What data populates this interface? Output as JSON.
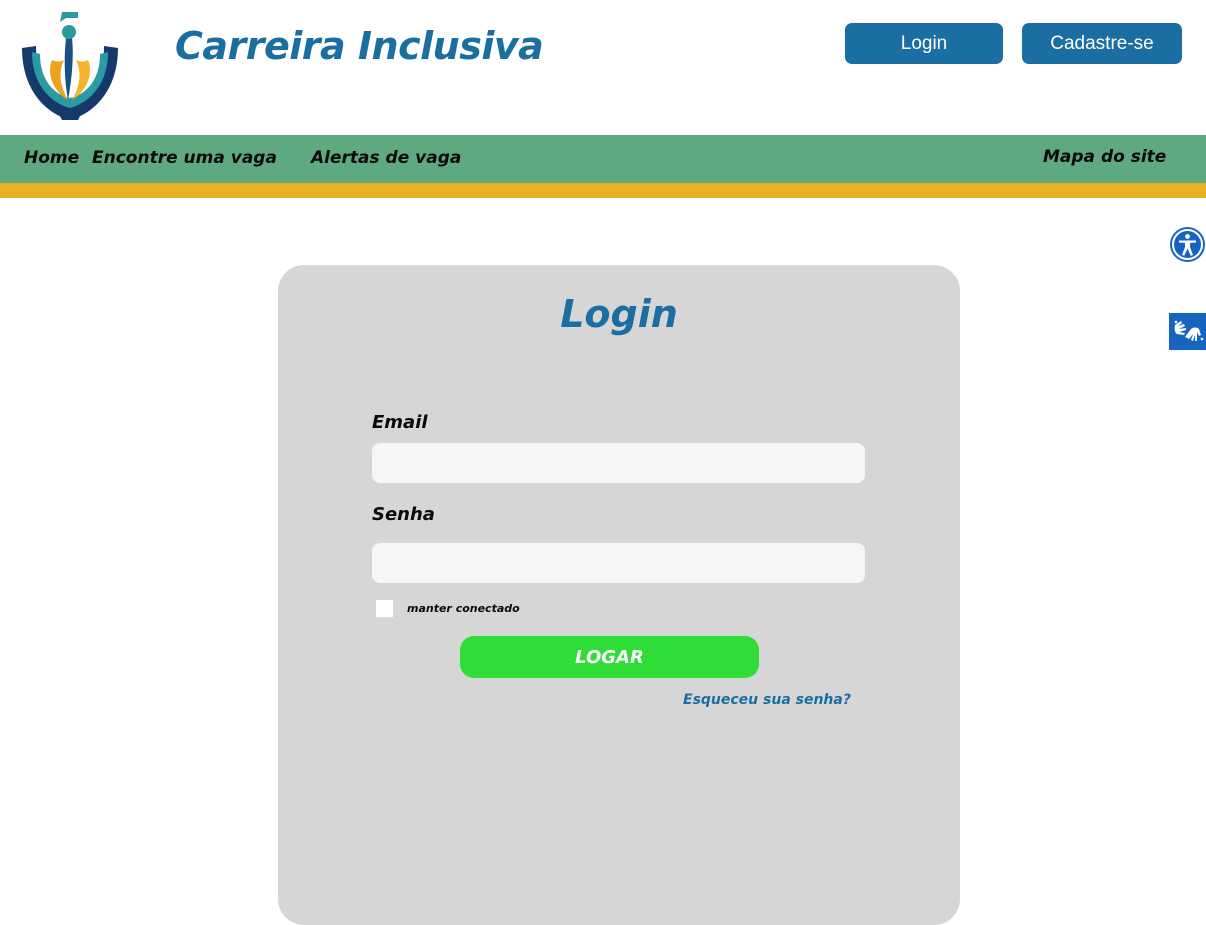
{
  "header": {
    "brand_name": "Carreira Inclusiva",
    "login_label": "Login",
    "signup_label": "Cadastre-se"
  },
  "nav": {
    "home": "Home",
    "find_job": "Encontre uma vaga",
    "job_alerts": "Alertas de vaga",
    "site_map": "Mapa do site"
  },
  "login_form": {
    "title": "Login",
    "email_label": "Email",
    "email_value": "",
    "password_label": "Senha",
    "password_value": "",
    "remember_label": "manter conectado",
    "remember_checked": false,
    "submit_label": "LOGAR",
    "forgot_label": "Esqueceu sua senha?"
  },
  "side_tools": {
    "accessibility_icon": "accessibility-icon",
    "sign_language_icon": "sign-language-icon"
  },
  "colors": {
    "brand_blue": "#1b6ea1",
    "nav_green": "#5fa980",
    "nav_yellow": "#e5b31f",
    "card_gray": "#d6d6d6",
    "submit_green": "#2fdd37"
  }
}
